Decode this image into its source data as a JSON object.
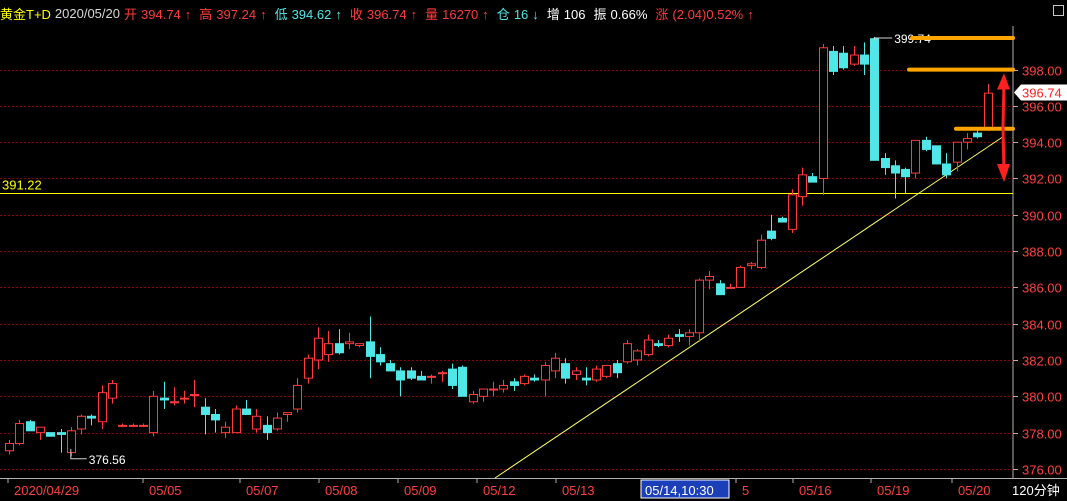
{
  "header": {
    "instrument": "黄金T+D",
    "date": "2020/05/20",
    "open_label": "开",
    "open_value": "394.74",
    "high_label": "高",
    "high_value": "397.24",
    "low_label": "低",
    "low_value": "394.62",
    "close_label": "收",
    "close_value": "396.74",
    "volume_label": "量",
    "volume_value": "16270",
    "oi_label": "仓",
    "oi_value": "16",
    "inc_label": "增",
    "inc_value": "106",
    "amp_label": "振",
    "amp_value": "0.66%",
    "chg_label": "涨",
    "chg_value": "(2.04)0.52%",
    "up_arrow": "↑",
    "down_arrow": "↓"
  },
  "period_label": "120分钟",
  "colors": {
    "up": "#ff3b3b",
    "down": "#4fe7e7",
    "grid": "#8b0000",
    "hline": "#ffff00",
    "trend": "#ffff66",
    "levels": "#ffa500",
    "price_box": "#ffffff",
    "date_highlight": "#1a3fb8"
  },
  "chart_data": {
    "type": "candlestick",
    "y_range": [
      375.5,
      400.4
    ],
    "y_ticks": [
      "376.00",
      "378.00",
      "380.00",
      "382.00",
      "384.00",
      "386.00",
      "388.00",
      "390.00",
      "392.00",
      "394.00",
      "396.00",
      "398.00"
    ],
    "x_ticks": [
      "2020/04/29",
      "05/05",
      "05/07",
      "05/08",
      "05/09",
      "05/12",
      "05/13",
      "05/14,10:30",
      "5",
      "05/16",
      "05/19",
      "05/20"
    ],
    "candles": [
      [
        377.0,
        377.6,
        376.8,
        377.4
      ],
      [
        377.4,
        378.7,
        377.3,
        378.5
      ],
      [
        378.6,
        378.7,
        378.1,
        378.1
      ],
      [
        378.0,
        378.3,
        377.6,
        378.3
      ],
      [
        378.0,
        378.0,
        377.8,
        377.8
      ],
      [
        378.0,
        378.2,
        376.9,
        377.9
      ],
      [
        376.9,
        378.3,
        376.7,
        378.1
      ],
      [
        378.2,
        379.0,
        377.9,
        378.9
      ],
      [
        378.9,
        379.0,
        378.4,
        378.8
      ],
      [
        378.6,
        380.6,
        378.2,
        380.2
      ],
      [
        379.9,
        380.9,
        379.6,
        380.7
      ],
      [
        378.4,
        378.5,
        378.3,
        378.4
      ],
      [
        378.4,
        378.5,
        378.3,
        378.4
      ],
      [
        378.4,
        378.5,
        378.3,
        378.4
      ],
      [
        378.0,
        380.3,
        377.8,
        380.0
      ],
      [
        379.9,
        380.8,
        379.3,
        379.8
      ],
      [
        379.7,
        380.5,
        379.5,
        379.7
      ],
      [
        379.9,
        380.3,
        379.6,
        379.9
      ],
      [
        380.1,
        380.9,
        379.4,
        380.1
      ],
      [
        379.4,
        379.9,
        377.9,
        379.0
      ],
      [
        379.0,
        379.3,
        378.0,
        378.7
      ],
      [
        378.0,
        378.6,
        377.7,
        378.3
      ],
      [
        378.0,
        379.5,
        378.0,
        379.3
      ],
      [
        379.3,
        379.8,
        379.1,
        379.0
      ],
      [
        378.2,
        379.3,
        378.0,
        378.9
      ],
      [
        378.4,
        378.9,
        377.6,
        378.0
      ],
      [
        378.2,
        379.1,
        378.1,
        378.8
      ],
      [
        379.0,
        379.1,
        378.6,
        379.1
      ],
      [
        379.3,
        381.0,
        379.1,
        380.6
      ],
      [
        381.0,
        382.3,
        380.7,
        382.1
      ],
      [
        382.0,
        383.8,
        381.5,
        383.2
      ],
      [
        382.3,
        383.6,
        381.9,
        382.9
      ],
      [
        382.9,
        383.7,
        382.3,
        382.4
      ],
      [
        382.9,
        383.5,
        382.6,
        383.0
      ],
      [
        382.8,
        382.9,
        382.7,
        382.9
      ],
      [
        383.0,
        384.4,
        381.0,
        382.2
      ],
      [
        382.3,
        382.7,
        381.7,
        381.9
      ],
      [
        381.8,
        382.0,
        381.6,
        381.4
      ],
      [
        381.4,
        381.6,
        380.0,
        380.9
      ],
      [
        381.4,
        381.6,
        380.9,
        381.0
      ],
      [
        381.1,
        381.4,
        381.0,
        380.9
      ],
      [
        381.1,
        381.2,
        380.7,
        381.1
      ],
      [
        381.3,
        381.4,
        380.8,
        381.3
      ],
      [
        381.5,
        381.8,
        380.4,
        380.6
      ],
      [
        381.6,
        381.7,
        380.0,
        380.0
      ],
      [
        379.7,
        380.3,
        379.6,
        380.1
      ],
      [
        380.0,
        380.4,
        379.7,
        380.4
      ],
      [
        380.4,
        380.8,
        380.0,
        380.4
      ],
      [
        380.4,
        380.9,
        380.2,
        380.6
      ],
      [
        380.8,
        381.0,
        380.3,
        380.6
      ],
      [
        380.7,
        381.2,
        380.6,
        381.1
      ],
      [
        381.0,
        381.2,
        380.8,
        380.9
      ],
      [
        380.9,
        381.9,
        380.0,
        381.7
      ],
      [
        381.4,
        382.4,
        381.0,
        382.1
      ],
      [
        381.8,
        382.1,
        380.7,
        381.0
      ],
      [
        381.2,
        381.6,
        380.9,
        381.4
      ],
      [
        381.0,
        381.6,
        380.6,
        380.9
      ],
      [
        380.9,
        381.7,
        380.8,
        381.5
      ],
      [
        381.1,
        381.7,
        381.0,
        381.7
      ],
      [
        381.8,
        382.0,
        381.0,
        381.3
      ],
      [
        381.9,
        383.1,
        381.8,
        382.9
      ],
      [
        382.0,
        382.6,
        381.7,
        382.5
      ],
      [
        382.3,
        383.4,
        382.2,
        383.1
      ],
      [
        382.9,
        383.1,
        382.7,
        382.8
      ],
      [
        382.8,
        383.4,
        382.7,
        383.2
      ],
      [
        383.4,
        383.7,
        383.0,
        383.3
      ],
      [
        383.3,
        383.7,
        382.8,
        383.5
      ],
      [
        383.5,
        386.5,
        383.0,
        386.4
      ],
      [
        386.4,
        386.9,
        385.9,
        386.6
      ],
      [
        386.2,
        386.4,
        385.7,
        385.6
      ],
      [
        386.0,
        386.2,
        386.0,
        386.0
      ],
      [
        386.0,
        387.2,
        386.0,
        387.1
      ],
      [
        387.2,
        387.4,
        387.0,
        387.3
      ],
      [
        387.1,
        388.9,
        387.0,
        388.6
      ],
      [
        389.1,
        390.0,
        388.6,
        388.7
      ],
      [
        389.8,
        389.9,
        389.6,
        389.6
      ],
      [
        389.2,
        391.4,
        389.0,
        391.1
      ],
      [
        391.0,
        392.6,
        390.5,
        392.2
      ],
      [
        392.1,
        392.3,
        391.8,
        391.8
      ],
      [
        392.0,
        399.4,
        391.1,
        399.2
      ],
      [
        399.0,
        399.3,
        397.7,
        397.9
      ],
      [
        398.9,
        399.3,
        398.0,
        398.1
      ],
      [
        398.3,
        399.3,
        398.2,
        398.8
      ],
      [
        398.8,
        399.5,
        397.7,
        398.3
      ],
      [
        399.7,
        399.8,
        393.0,
        393.0
      ],
      [
        393.1,
        393.4,
        392.2,
        392.6
      ],
      [
        392.7,
        393.0,
        390.9,
        392.3
      ],
      [
        392.5,
        392.6,
        391.2,
        392.1
      ],
      [
        392.3,
        394.1,
        392.0,
        394.1
      ],
      [
        394.1,
        394.3,
        393.5,
        393.6
      ],
      [
        393.8,
        393.8,
        392.9,
        392.8
      ],
      [
        392.8,
        393.4,
        392.0,
        392.2
      ],
      [
        392.9,
        394.0,
        392.4,
        394.0
      ],
      [
        394.0,
        394.5,
        393.6,
        394.2
      ],
      [
        394.5,
        394.8,
        394.2,
        394.3
      ],
      [
        394.7,
        397.2,
        394.6,
        396.7
      ]
    ],
    "hline": {
      "label": "391.22",
      "value": 391.22
    },
    "low_marker": {
      "label": "376.56",
      "value": 376.56
    },
    "high_marker": {
      "label": "399.74",
      "value": 399.74
    },
    "trendline": {
      "from": [
        495,
        375.5
      ],
      "to": [
        1003,
        394.3
      ]
    },
    "levels": [
      399.74,
      398.0,
      394.74
    ],
    "last_price": "396.74",
    "highlighted_x_tick": "05/14,10:30"
  }
}
